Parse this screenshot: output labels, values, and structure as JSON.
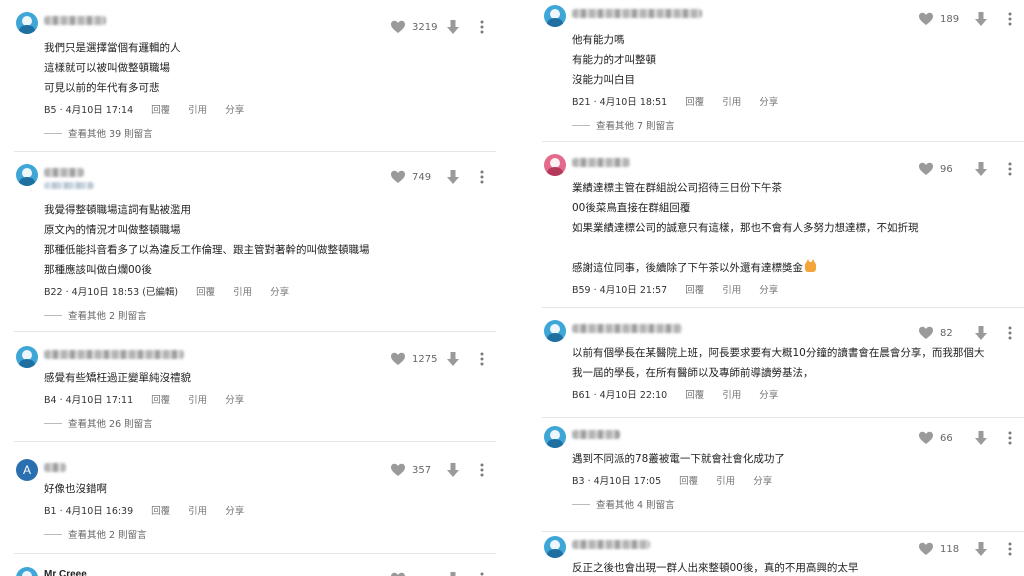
{
  "actions": {
    "reply": "回覆",
    "quote": "引用",
    "share": "分享"
  },
  "left": [
    {
      "avatar": "blue",
      "likes": "3219",
      "lines": [
        "我們只是選擇當個有邏輯的人",
        "這樣就可以被叫做整頓職場",
        "可見以前的年代有多可悲"
      ],
      "meta": "B5 · 4月10日 17:14",
      "replies": "查看其他 39 則留言"
    },
    {
      "avatar": "blue",
      "likes": "749",
      "lines": [
        "我覺得整頓職場這詞有點被濫用",
        "原文內的情況才叫做整頓職場",
        "那種低能抖音看多了以為違反工作倫理、跟主管對著幹的叫做整頓職場",
        "那種應該叫做白爛00後"
      ],
      "meta": "B22 · 4月10日 18:53 (已編輯)",
      "replies": "查看其他 2 則留言"
    },
    {
      "avatar": "blue",
      "likes": "1275",
      "lines": [
        "感覺有些矯枉過正變單純沒禮貌"
      ],
      "meta": "B4 · 4月10日 17:11",
      "replies": "查看其他 26 則留言"
    },
    {
      "avatar": "letter",
      "avatar_letter": "A",
      "likes": "357",
      "lines": [
        "好像也沒錯啊"
      ],
      "meta": "B1 · 4月10日 16:39",
      "replies": "查看其他 2 則留言"
    },
    {
      "avatar": "blue",
      "name": "Mr Creee",
      "likes": "",
      "lines": [],
      "meta": "",
      "replies": ""
    }
  ],
  "right": [
    {
      "avatar": "blue",
      "likes": "189",
      "lines": [
        "他有能力嗎",
        "有能力的才叫整頓",
        "沒能力叫白目"
      ],
      "meta": "B21 · 4月10日 18:51",
      "replies": "查看其他 7 則留言"
    },
    {
      "avatar": "pink",
      "likes": "96",
      "lines": [
        "業績達標主管在群組說公司招待三日份下午茶",
        "00後菜鳥直接在群組回覆",
        "如果業績達標公司的誠意只有這樣，那也不會有人多努力想達標，不如折現",
        "",
        "感謝這位同事，後續除了下午茶以外還有達標獎金"
      ],
      "emoji_on_last": "cat-emoji",
      "meta": "B59 · 4月10日 21:57",
      "replies": ""
    },
    {
      "avatar": "blue",
      "likes": "82",
      "lines": [
        "以前有個學長在某醫院上班，阿長要求要有大概10分鐘的讀書會在晨會分享，而我那個大",
        "我一屆的學長，在所有醫師以及專師前導讀勞基法，"
      ],
      "meta": "B61 · 4月10日 22:10",
      "replies": ""
    },
    {
      "avatar": "blue",
      "likes": "66",
      "lines": [
        "遇到不同派的78叢被電一下就會社會化成功了"
      ],
      "meta": "B3 · 4月10日 17:05",
      "replies": "查看其他 4 則留言"
    },
    {
      "avatar": "blue",
      "likes": "118",
      "lines": [
        "反正之後也會出現一群人出來整頓00後，真的不用高興的太早"
      ],
      "meta": "",
      "replies": ""
    }
  ]
}
